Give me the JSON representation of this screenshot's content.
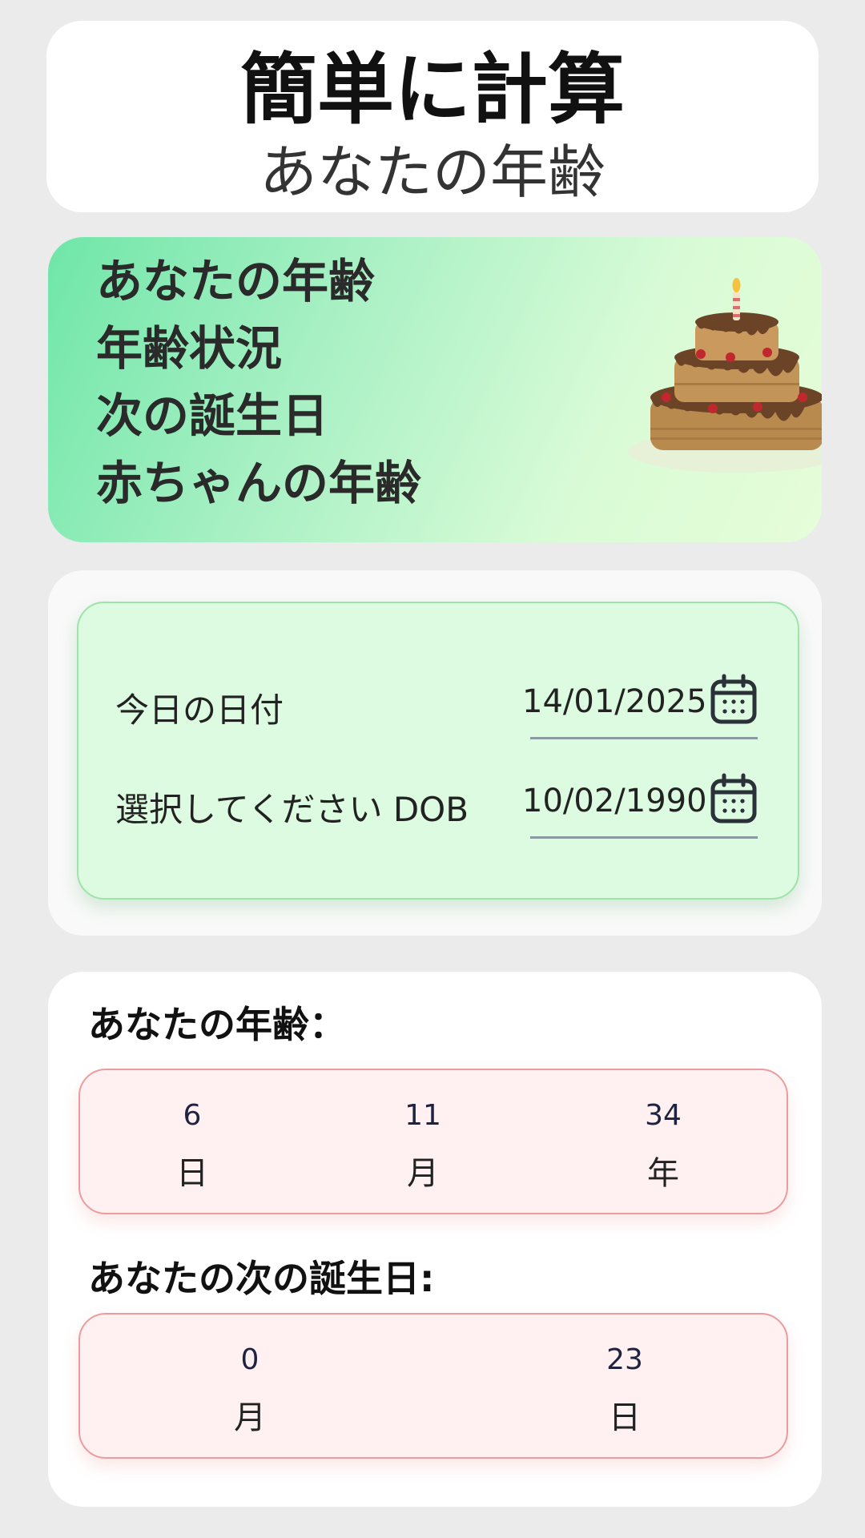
{
  "header": {
    "title": "簡単に計算",
    "subtitle": "あなたの年齢"
  },
  "banner": {
    "lines": [
      "あなたの年齢",
      "年齢状況",
      "次の誕生日",
      "赤ちゃんの年齢"
    ],
    "illustration": "birthday-cake"
  },
  "form": {
    "today_label": "今日の日付",
    "today_value": "14/01/2025",
    "dob_label": "選択してください DOB",
    "dob_value": "10/02/1990",
    "icon": "calendar-icon"
  },
  "results": {
    "age_title": "あなたの年齢：",
    "age": [
      {
        "value": "6",
        "unit": "日"
      },
      {
        "value": "11",
        "unit": "月"
      },
      {
        "value": "34",
        "unit": "年"
      }
    ],
    "next_title": "あなたの次の誕生日:",
    "next_birthday": [
      {
        "value": "0",
        "unit": "月"
      },
      {
        "value": "23",
        "unit": "日"
      }
    ]
  },
  "colors": {
    "background": "#ebebeb",
    "banner_gradient_start": "#6fe6a8",
    "input_panel": "#dcfbe0",
    "input_panel_border": "#9ee3a8",
    "result_box": "#fff1f1",
    "result_box_border": "#ec9c9c"
  }
}
